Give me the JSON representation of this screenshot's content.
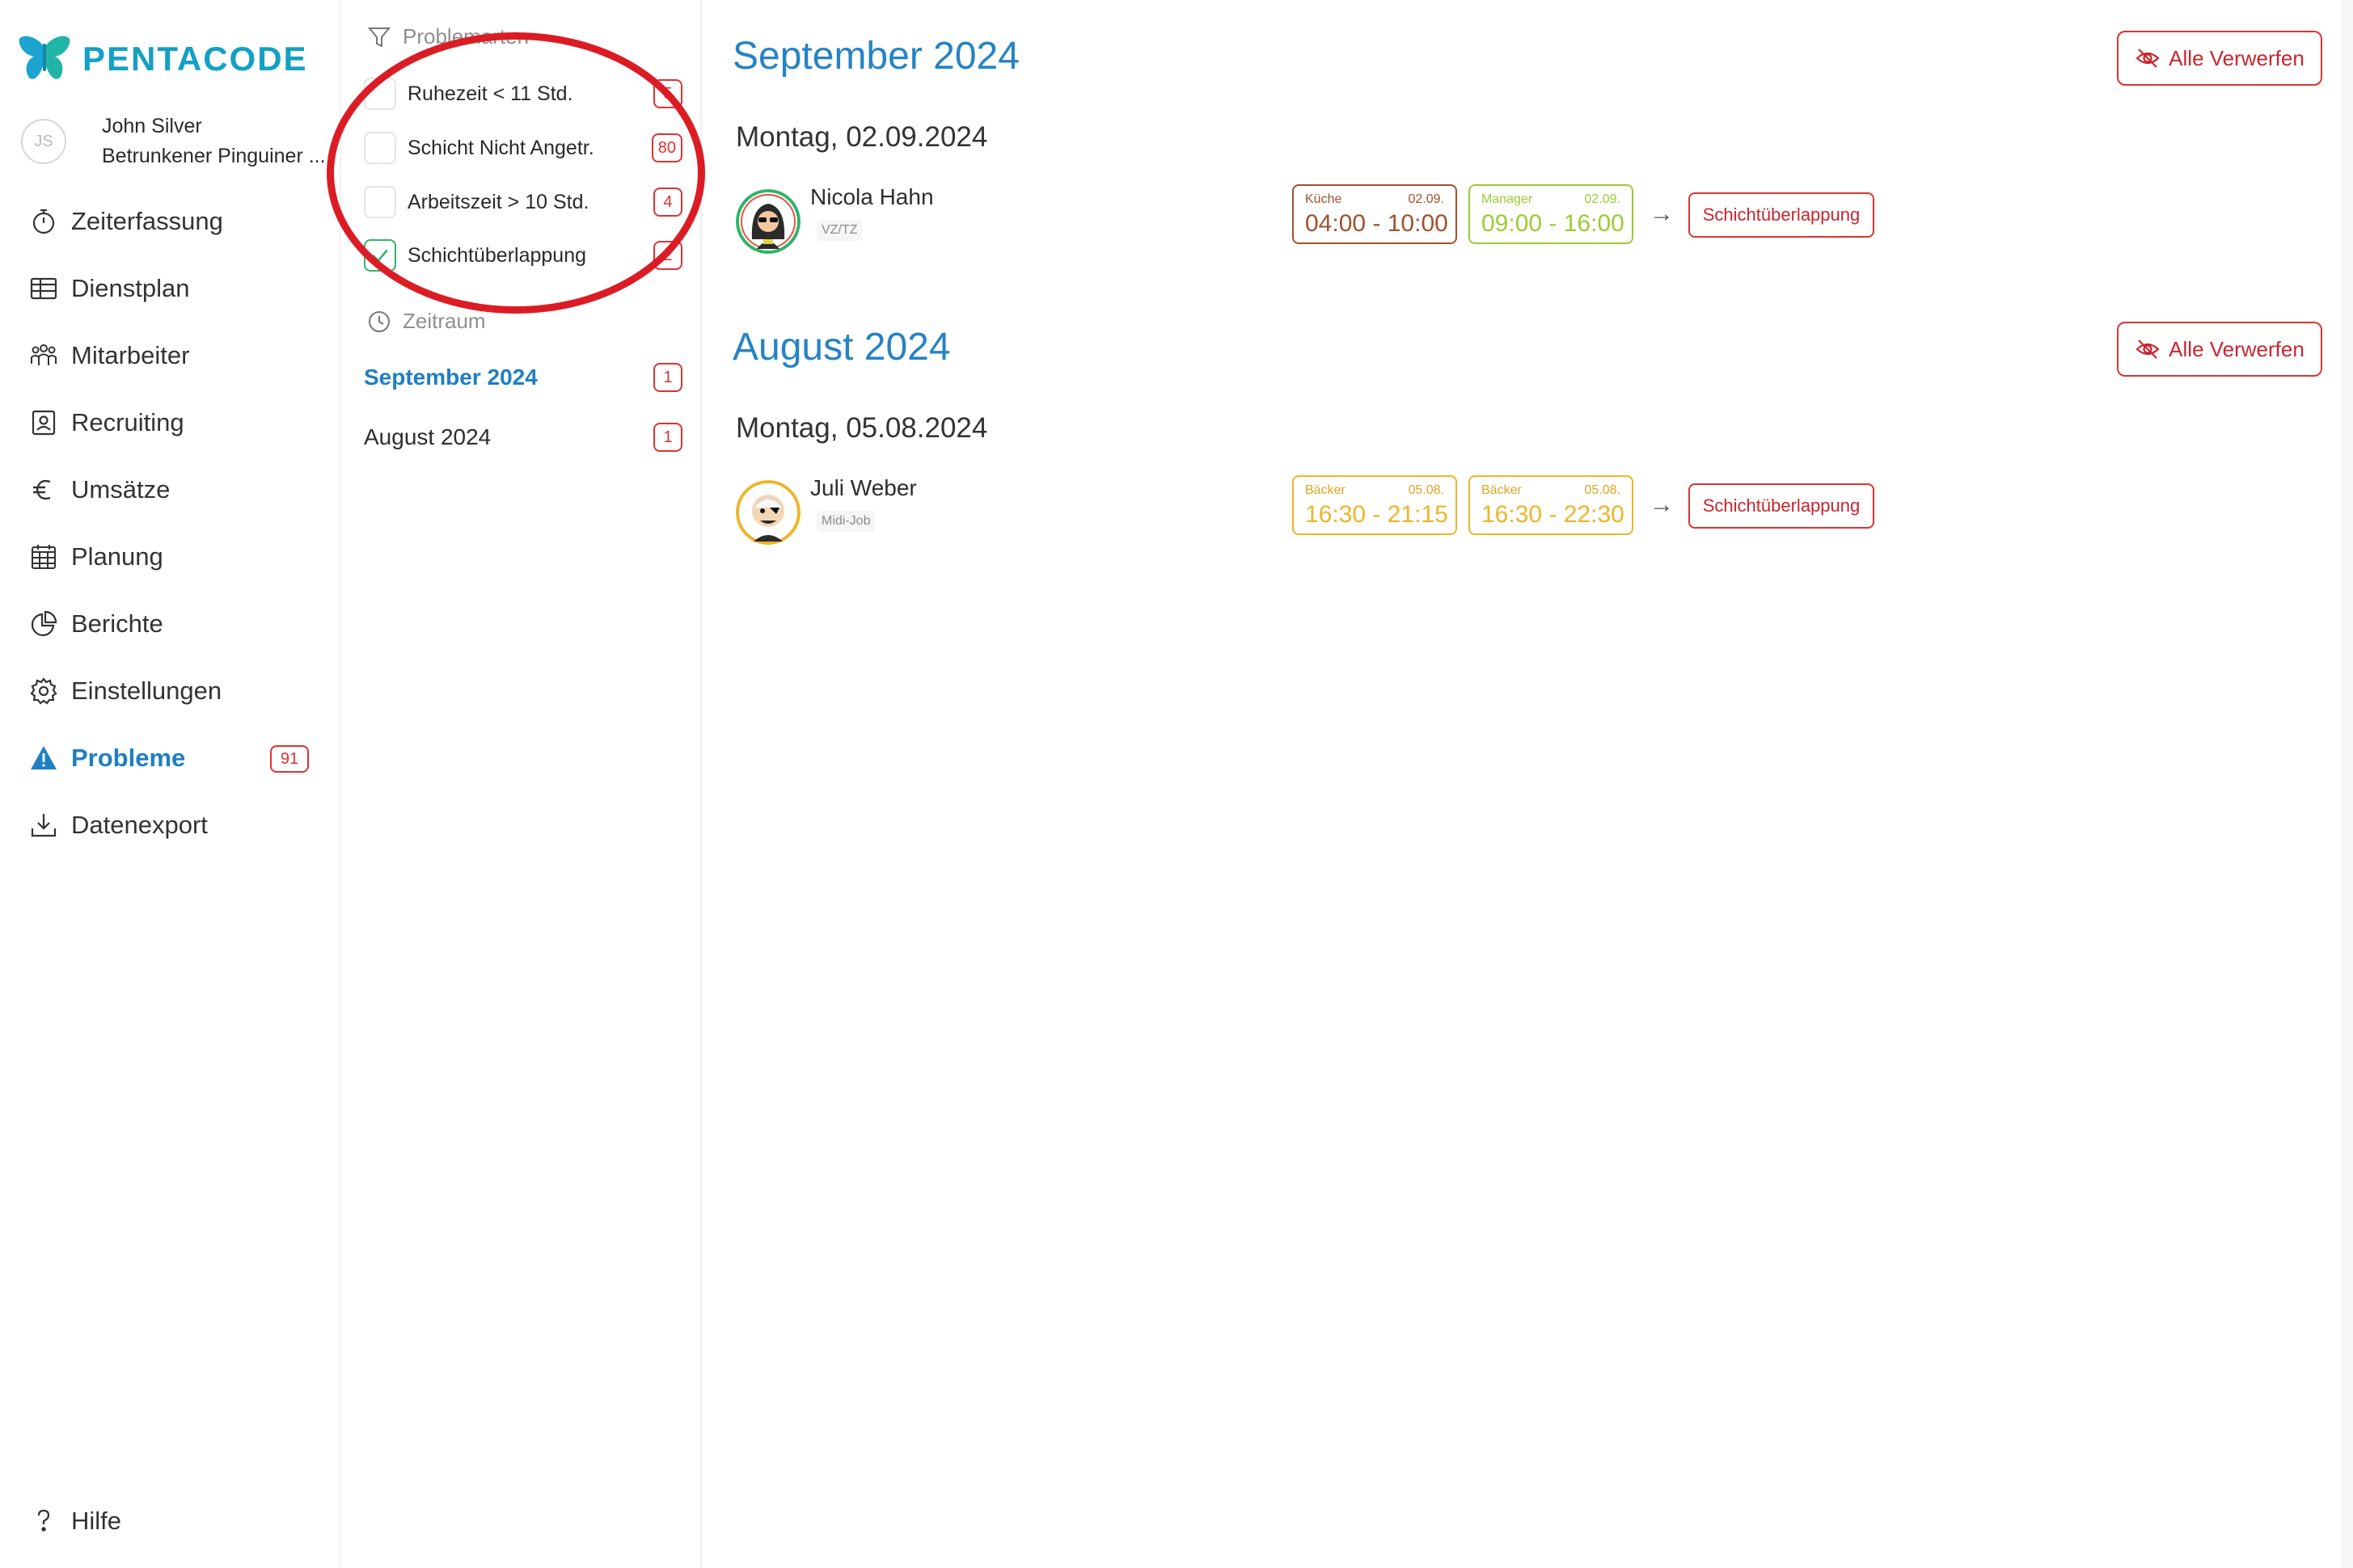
{
  "app": {
    "logo_text": "PENTACODE"
  },
  "user": {
    "initials": "JS",
    "name": "John Silver",
    "org": "Betrunkener Pinguiner ..."
  },
  "nav": {
    "items": [
      {
        "label": "Zeiterfassung",
        "icon": "stopwatch-icon"
      },
      {
        "label": "Dienstplan",
        "icon": "table-icon"
      },
      {
        "label": "Mitarbeiter",
        "icon": "people-icon"
      },
      {
        "label": "Recruiting",
        "icon": "id-card-icon"
      },
      {
        "label": "Umsätze",
        "icon": "euro-icon"
      },
      {
        "label": "Planung",
        "icon": "calendar-icon"
      },
      {
        "label": "Berichte",
        "icon": "pie-chart-icon"
      },
      {
        "label": "Einstellungen",
        "icon": "gear-icon"
      },
      {
        "label": "Probleme",
        "icon": "warning-icon",
        "badge": "91",
        "active": true
      },
      {
        "label": "Datenexport",
        "icon": "download-icon"
      }
    ],
    "help": "Hilfe"
  },
  "filter": {
    "heading": "Problemarten",
    "types": [
      {
        "label": "Ruhezeit < 11 Std.",
        "count": "5",
        "checked": false
      },
      {
        "label": "Schicht Nicht Angetr.",
        "count": "80",
        "checked": false
      },
      {
        "label": "Arbeitszeit > 10 Std.",
        "count": "4",
        "checked": false
      },
      {
        "label": "Schichtüberlappung",
        "count": "2",
        "checked": true
      }
    ],
    "period_heading": "Zeitraum",
    "periods": [
      {
        "label": "September 2024",
        "count": "1",
        "active": true
      },
      {
        "label": "August 2024",
        "count": "1",
        "active": false
      }
    ]
  },
  "groups": [
    {
      "month": "September 2024",
      "discard_label": "Alle Verwerfen",
      "day": "Montag, 02.09.2024",
      "employee": {
        "name": "Nicola Hahn",
        "tag": "VZ/TZ",
        "ring_color": "#e5533d"
      },
      "shifts": [
        {
          "role": "Küche",
          "date": "02.09.",
          "time": "04:00 - 10:00",
          "color": "#a0522d"
        },
        {
          "role": "Manager",
          "date": "02.09.",
          "time": "09:00 - 16:00",
          "color": "#9acd32"
        }
      ],
      "problem_label": "Schichtüberlappung"
    },
    {
      "month": "August 2024",
      "discard_label": "Alle Verwerfen",
      "day": "Montag, 05.08.2024",
      "employee": {
        "name": "Juli Weber",
        "tag": "Midi-Job",
        "ring_color": "#f0b429"
      },
      "shifts": [
        {
          "role": "Bäcker",
          "date": "05.08.",
          "time": "16:30 - 21:15",
          "color": "#f0b429"
        },
        {
          "role": "Bäcker",
          "date": "05.08.",
          "time": "16:30 - 22:30",
          "color": "#f0b429"
        }
      ],
      "problem_label": "Schichtüberlappung"
    }
  ],
  "colors": {
    "accent": "#1f7fc1",
    "danger": "#d33333",
    "brand": "#14a0c4",
    "annotation": "#dc1c24"
  }
}
